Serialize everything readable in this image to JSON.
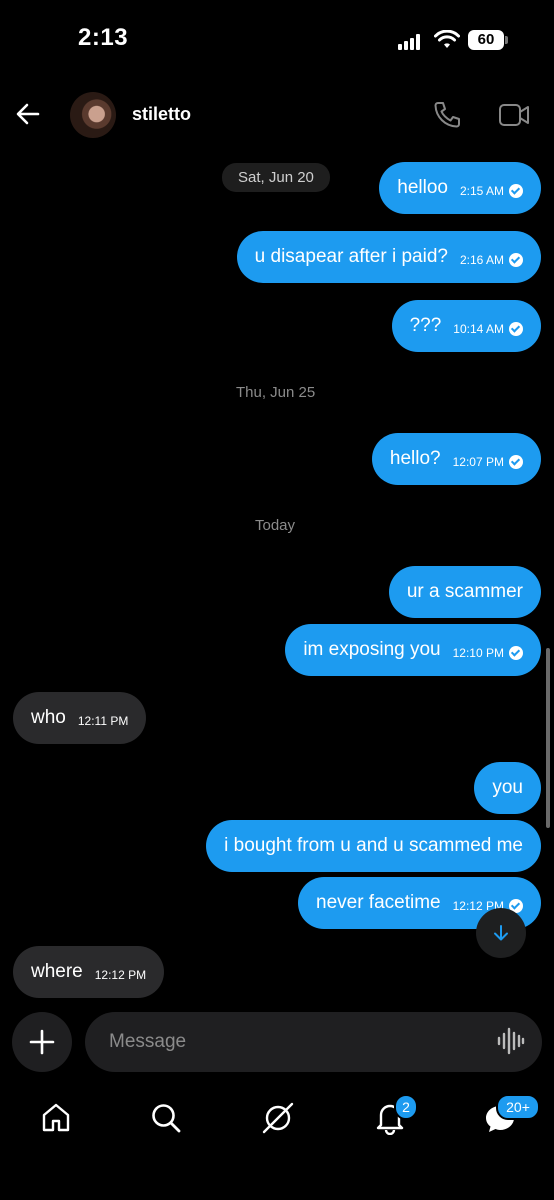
{
  "status_bar": {
    "time": "2:13",
    "battery": "60"
  },
  "header": {
    "contact_name": "stiletto"
  },
  "dates": {
    "d1": "Sat, Jun 20",
    "d2": "Thu, Jun 25",
    "d3": "Today"
  },
  "messages": [
    {
      "text": "helloo",
      "time": "2:15 AM"
    },
    {
      "text": "u disapear after i paid?",
      "time": "2:16 AM"
    },
    {
      "text": "???",
      "time": "10:14 AM"
    },
    {
      "text": "hello?",
      "time": "12:07 PM"
    },
    {
      "text": "ur a scammer",
      "time": ""
    },
    {
      "text": "im exposing you",
      "time": "12:10 PM"
    },
    {
      "text": "who",
      "time": "12:11 PM"
    },
    {
      "text": "you",
      "time": ""
    },
    {
      "text": "i bought from u and u scammed me",
      "time": ""
    },
    {
      "text": "never facetime",
      "time": "12:12 PM"
    },
    {
      "text": "where",
      "time": "12:12 PM"
    }
  ],
  "composer": {
    "placeholder": "Message"
  },
  "tabbar": {
    "notifications_badge": "2",
    "messages_badge": "20+"
  },
  "colors": {
    "accent": "#1d9bf0",
    "incoming_bubble": "#2a2a2c",
    "background": "#000000"
  }
}
